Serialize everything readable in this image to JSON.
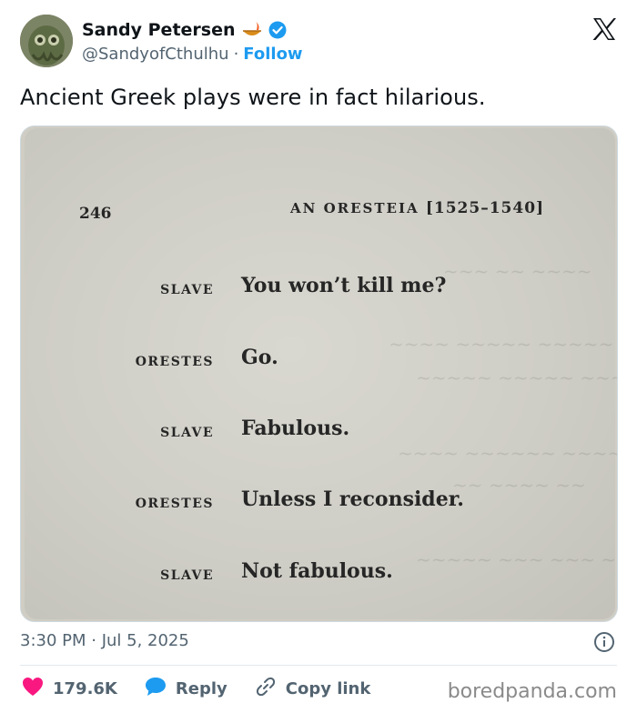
{
  "author": {
    "display_name": "Sandy Petersen",
    "handle": "@SandyofCthulhu",
    "separator": "·",
    "follow_label": "Follow"
  },
  "tweet": {
    "text": "Ancient Greek plays were in fact hilarious.",
    "timestamp": "3:30 PM · Jul 5, 2025"
  },
  "book_page": {
    "page_number": "246",
    "running_head": "AN ORESTEIA",
    "line_range": "[1525–1540]",
    "dialogue": [
      {
        "speaker": "SLAVE",
        "line": "You won’t kill me?"
      },
      {
        "speaker": "ORESTES",
        "line": "Go."
      },
      {
        "speaker": "SLAVE",
        "line": "Fabulous."
      },
      {
        "speaker": "ORESTES",
        "line": "Unless I reconsider."
      },
      {
        "speaker": "SLAVE",
        "line": "Not fabulous."
      }
    ]
  },
  "actions": {
    "likes": "179.6K",
    "reply_label": "Reply",
    "copy_link_label": "Copy link"
  },
  "watermark": "boredpanda.com",
  "colors": {
    "accent": "#1d9bf0",
    "like": "#f91880",
    "muted": "#536471"
  }
}
